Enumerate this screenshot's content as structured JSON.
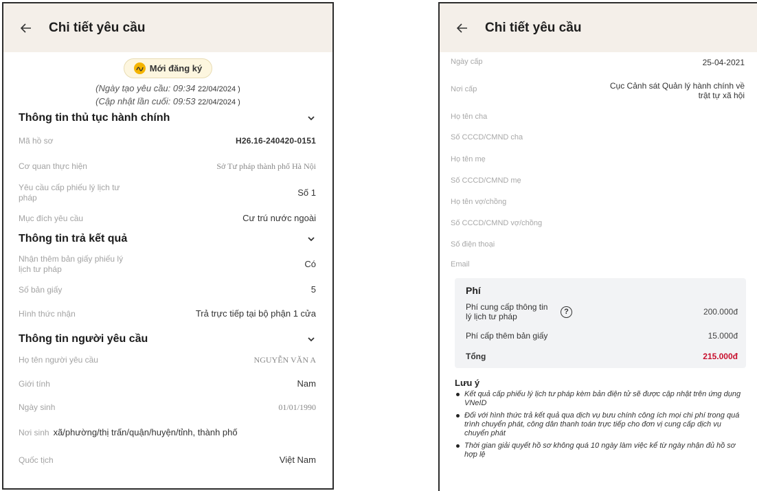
{
  "left": {
    "title": "Chi tiết yêu cầu",
    "badge": "Mới đăng ký",
    "created_label": "(Ngày tạo yêu cầu: 09:34",
    "created_date": "22/04/2024 )",
    "updated_label": "(Cập nhật lần cuối: 09:53",
    "updated_date": "22/04/2024 )",
    "sections": {
      "procedure": {
        "title": "Thông tin thủ tục hành chính",
        "rows": [
          {
            "label": "Mã hồ sơ",
            "value": "H26.16-240420-0151"
          },
          {
            "label": "Cơ quan thực hiện",
            "value": "Sở Tư pháp thành phố Hà Nội"
          },
          {
            "label": "Yêu cầu cấp phiếu lý lịch tư pháp",
            "value": "Số 1"
          },
          {
            "label": "Mục đích yêu cầu",
            "value": "Cư trú nước ngoài"
          }
        ]
      },
      "result": {
        "title": "Thông tin trả kết quả",
        "rows": [
          {
            "label": "Nhận thêm bản giấy phiếu lý lịch tư pháp",
            "value": "Có"
          },
          {
            "label": "Số bản giấy",
            "value": "5"
          },
          {
            "label": "Hình thức nhận",
            "value": "Trả trực tiếp tại bộ phận 1 cửa"
          }
        ]
      },
      "requester": {
        "title": "Thông tin người yêu cầu",
        "rows": [
          {
            "label": "Họ tên người yêu cầu",
            "value": "NGUYỄN VĂN A"
          },
          {
            "label": "Giới tính",
            "value": "Nam"
          },
          {
            "label": "Ngày sinh",
            "value": "01/01/1990"
          },
          {
            "label": "Nơi sinh",
            "value": "xã/phường/thị trấn/quận/huyện/tỉnh, thành phố"
          },
          {
            "label": "Quốc tịch",
            "value": "Việt Nam"
          }
        ]
      }
    }
  },
  "right": {
    "title": "Chi tiết yêu cầu",
    "rows": [
      {
        "label": "Ngày cấp",
        "value": "25-04-2021"
      },
      {
        "label": "Nơi cấp",
        "value": "Cục Cảnh sát Quản lý hành chính về trật tự xã hội"
      },
      {
        "label": "Họ tên cha",
        "value": ""
      },
      {
        "label": "Số CCCD/CMND cha",
        "value": ""
      },
      {
        "label": "Họ tên mẹ",
        "value": ""
      },
      {
        "label": "Số CCCD/CMND mẹ",
        "value": ""
      },
      {
        "label": "Họ tên vợ/chồng",
        "value": ""
      },
      {
        "label": "Số CCCD/CMND vợ/chồng",
        "value": ""
      },
      {
        "label": "Số điện thoại",
        "value": ""
      },
      {
        "label": "Email",
        "value": ""
      }
    ],
    "fees": {
      "title": "Phí",
      "info_fee_label": "Phí cung cấp thông tin lý lịch tư pháp",
      "info_fee_value": "200.000đ",
      "copy_fee_label": "Phí cấp thêm bản giấy",
      "copy_fee_value": "15.000đ",
      "total_label": "Tổng",
      "total_value": "215.000đ"
    },
    "notes": {
      "title": "Lưu ý",
      "items": [
        "Kết quả cấp phiếu lý lịch tư pháp kèm bản điện tử sẽ được cập nhật trên ứng dụng VNeID",
        "Đối với hình thức trả kết quả qua dịch vụ bưu chính công ích mọi chi phí trong quá trình chuyển phát, công dân thanh toán trực tiếp cho đơn vị cung cấp dịch vụ chuyển phát",
        "Thời gian giải quyết hồ sơ không quá 10 ngày làm việc kể từ ngày nhận đủ hồ sơ hợp lệ"
      ]
    }
  },
  "colors": {
    "appbar": "#f4efe9",
    "badge_icon": "#f4b400",
    "total": "#c8102e",
    "fee_box": "#f2f3f5"
  },
  "icons": [
    "back-arrow-icon",
    "status-icon",
    "chevron-down-icon",
    "help-circle-icon"
  ]
}
